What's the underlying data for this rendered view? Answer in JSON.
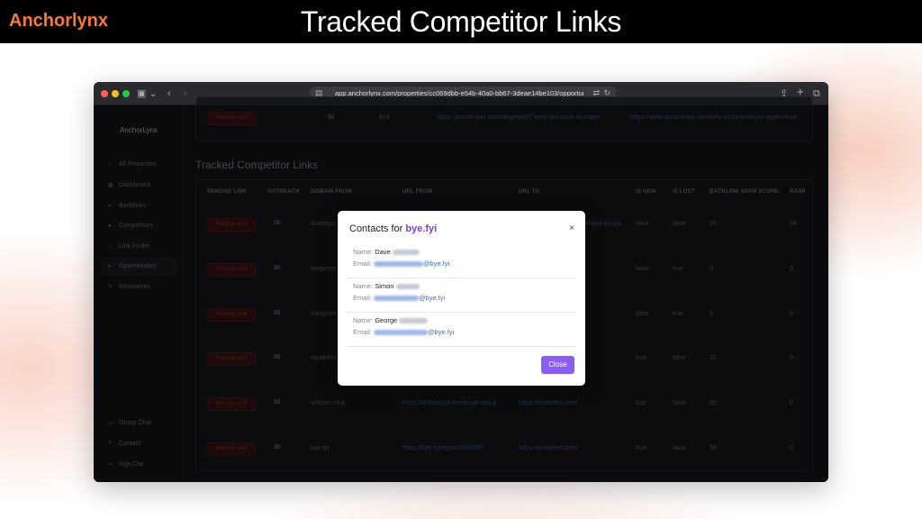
{
  "header": {
    "brand": "Anchorlynx",
    "headline": "Tracked Competitor Links"
  },
  "browser": {
    "url": "app.anchorlynx.com/properties/cc069dbb-e54b-40a0-bb67-3deae14be103/opportunitie"
  },
  "sidebar": {
    "logo": "AnchorLynx",
    "items": [
      {
        "label": "All Properties",
        "icon": "home-icon"
      },
      {
        "label": "Dashboard",
        "icon": "dashboard-icon"
      },
      {
        "label": "Backlinks",
        "icon": "link-icon"
      },
      {
        "label": "Competitors",
        "icon": "users-icon"
      },
      {
        "label": "Link Finder",
        "icon": "search-icon"
      },
      {
        "label": "Opportunities",
        "icon": "pin-icon"
      },
      {
        "label": "Recoveries",
        "icon": "wrench-icon"
      }
    ],
    "bottom": [
      {
        "label": "Group Chat",
        "icon": "chat-icon"
      },
      {
        "label": "Contact",
        "icon": "help-icon"
      },
      {
        "label": "Sign Out",
        "icon": "signout-icon"
      }
    ]
  },
  "top_row": {
    "button": "Remove Link",
    "status": "404",
    "url_from": "https://anchorlynx.com/blog/fake/7-best-seo-tools-to-super",
    "url_to": "https://www.accuranker.com/why-accuranker/for-agencies/e"
  },
  "table": {
    "title": "Tracked Competitor Links",
    "headers": [
      "REMOVE LINK",
      "OUTREACH",
      "DOMAIN FROM",
      "URL FROM",
      "URL TO",
      "IS NEW",
      "IS LOST",
      "BACKLINK SPAM SCORE",
      "RANK"
    ],
    "rows": [
      {
        "button": "Remove Link",
        "domain": "budokyoi",
        "url_from": "",
        "url_to": "erapia-ocupa",
        "is_new": "false",
        "is_lost": "false",
        "spam": "25",
        "rank": "58"
      },
      {
        "button": "Remove Link",
        "domain": "sergeche",
        "url_from": "",
        "url_to": "",
        "is_new": "false",
        "is_lost": "true",
        "spam": "0",
        "rank": "0"
      },
      {
        "button": "Remove Link",
        "domain": "komprom",
        "url_from": "",
        "url_to": "",
        "is_new": "false",
        "is_lost": "true",
        "spam": "0",
        "rank": "0"
      },
      {
        "button": "Remove Link",
        "domain": "royalseot",
        "url_from": "",
        "url_to": "",
        "is_new": "true",
        "is_lost": "false",
        "spam": "30",
        "rank": "0"
      },
      {
        "button": "Remove Link",
        "domain": "driftseo.click",
        "url_from": "https://driftseo.click/manual-seo-p",
        "url_to": "https://evatellez.com/",
        "is_new": "true",
        "is_lost": "false",
        "spam": "50",
        "rank": "0"
      },
      {
        "button": "Remove Link",
        "domain": "bye.fyi",
        "url_from": "https://bye.fyi/report/2495787",
        "url_to": "https://evatellez.com/",
        "is_new": "true",
        "is_lost": "false",
        "spam": "50",
        "rank": "0"
      }
    ]
  },
  "modal": {
    "title_prefix": "Contacts for",
    "domain": "bye.fyi",
    "close_x": "×",
    "name_label": "Name:",
    "email_label": "Email:",
    "contacts": [
      {
        "first": "Dave",
        "email_domain": "@bye.fyi"
      },
      {
        "first": "Simon",
        "email_domain": "@bye.fyi"
      },
      {
        "first": "George",
        "email_domain": "@bye.fyi"
      }
    ],
    "close_button": "Close"
  }
}
